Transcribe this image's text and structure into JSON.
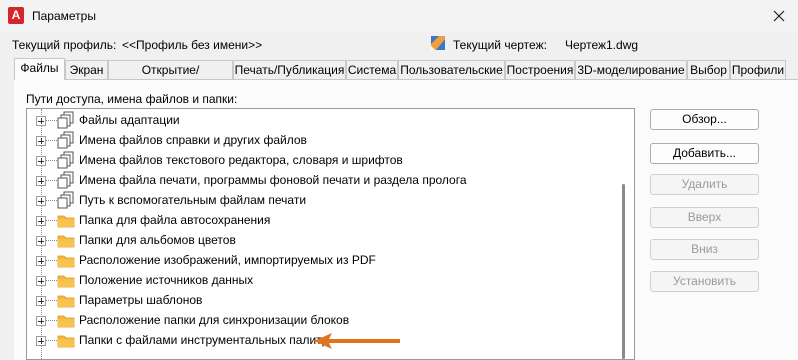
{
  "window": {
    "title": "Параметры",
    "app_icon_letter": "A"
  },
  "profile": {
    "label": "Текущий профиль:",
    "value": "<<Профиль без имени>>"
  },
  "drawing": {
    "label": "Текущий чертеж:",
    "value": "Чертеж1.dwg"
  },
  "tabs": [
    {
      "label": "Файлы",
      "active": true
    },
    {
      "label": "Экран"
    },
    {
      "label": "Открытие/Сохранение"
    },
    {
      "label": "Печать/Публикация"
    },
    {
      "label": "Система"
    },
    {
      "label": "Пользовательские"
    },
    {
      "label": "Построения"
    },
    {
      "label": "3D-моделирование"
    },
    {
      "label": "Выбор"
    },
    {
      "label": "Профили"
    }
  ],
  "tree": {
    "heading": "Пути доступа, имена файлов и папки:",
    "items": [
      {
        "label": "Файлы адаптации",
        "icon": "files-icon"
      },
      {
        "label": "Имена файлов справки и других файлов",
        "icon": "files-icon"
      },
      {
        "label": "Имена файлов текстового редактора, словаря и шрифтов",
        "icon": "files-icon"
      },
      {
        "label": "Имена файла печати, программы фоновой печати и раздела пролога",
        "icon": "files-icon"
      },
      {
        "label": "Путь к вспомогательным файлам печати",
        "icon": "files-icon"
      },
      {
        "label": "Папка для файла автосохранения",
        "icon": "folder-icon"
      },
      {
        "label": "Папки для альбомов цветов",
        "icon": "folder-icon"
      },
      {
        "label": "Расположение изображений, импортируемых из PDF",
        "icon": "folder-icon"
      },
      {
        "label": "Положение источников данных",
        "icon": "folder-icon"
      },
      {
        "label": "Параметры шаблонов",
        "icon": "folder-icon"
      },
      {
        "label": "Расположение папки для синхронизации блоков",
        "icon": "folder-icon"
      },
      {
        "label": "Папки с файлами инструментальных палитр",
        "icon": "folder-icon"
      }
    ]
  },
  "buttons": {
    "browse": "Обзор...",
    "add": "Добавить...",
    "remove": "Удалить",
    "move_up": "Вверх",
    "move_down": "Вниз",
    "set_current": "Установить"
  },
  "colors": {
    "accent_arrow": "#e2731e",
    "folder": "#f6b73c"
  }
}
